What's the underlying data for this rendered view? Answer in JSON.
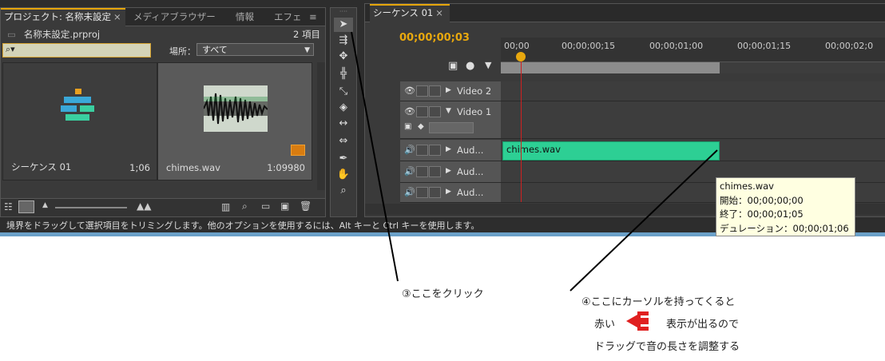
{
  "project_panel": {
    "tabs": [
      {
        "label": "プロジェクト: 名称未設定",
        "active": true
      },
      {
        "label": "メディアブラウザー",
        "active": false
      },
      {
        "label": "情報",
        "active": false
      },
      {
        "label": "エフェ",
        "active": false
      }
    ],
    "file_name": "名称未設定.prproj",
    "item_count": "2 項目",
    "search_placeholder": "",
    "location_label": "場所：",
    "location_value": "すべて",
    "items": [
      {
        "name": "シーケンス 01",
        "duration": "1;06"
      },
      {
        "name": "chimes.wav",
        "duration": "1:09980"
      }
    ]
  },
  "sequence_panel": {
    "tab_label": "シーケンス 01",
    "timecode": "00;00;00;03",
    "ruler_labels": [
      "00;00",
      "00;00;00;15",
      "00;00;01;00",
      "00;00;01;15",
      "00;00;02;0"
    ],
    "tracks": [
      {
        "name": "Video 2",
        "kind": "video"
      },
      {
        "name": "Video 1",
        "kind": "video"
      },
      {
        "name": "Aud...",
        "kind": "audio"
      },
      {
        "name": "Aud...",
        "kind": "audio"
      },
      {
        "name": "Aud...",
        "kind": "audio"
      }
    ],
    "clip_label": "chimes.wav",
    "tooltip": {
      "title": "chimes.wav",
      "start": "開始：00;00;00;00",
      "end": "終了：00;00;01;05",
      "duration": "デュレーション：00;00;01;06"
    }
  },
  "status_bar": "境界をドラッグして選択項目をトリミングします。他のオプションを使用するには、Alt キーと Ctrl キーを使用します。",
  "annotations": {
    "step3": "③ここをクリック",
    "step4_line1": "④ここにカーソルを持ってくると",
    "step4_red": "赤い",
    "step4_line2": "表示が出るので",
    "step4_line3": "ドラッグで音の長さを調整する"
  },
  "colors": {
    "accent": "#e8a80e",
    "clip": "#2dcf94",
    "playhead": "#d02020",
    "red_icon": "#e02020"
  }
}
